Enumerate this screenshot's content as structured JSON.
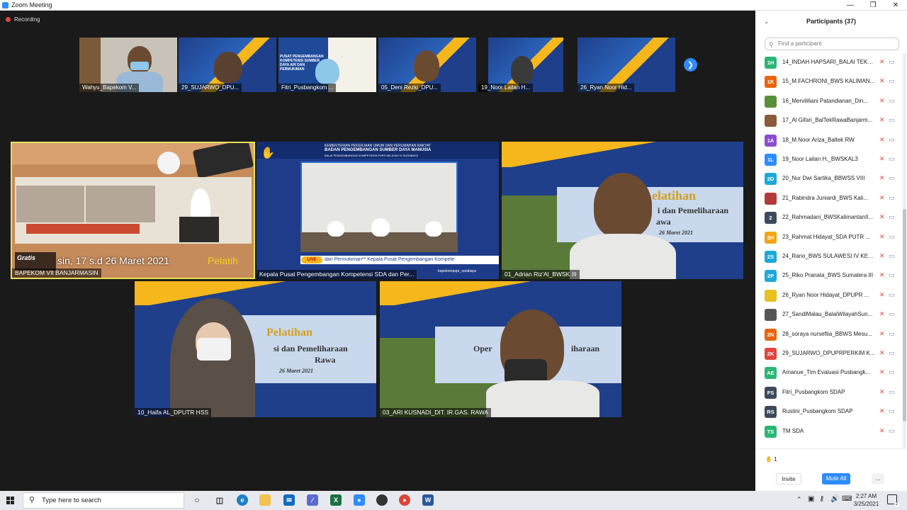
{
  "window": {
    "title": "Zoom Meeting"
  },
  "recording": {
    "label": "Recording"
  },
  "thumbnails": [
    {
      "label": "Wahyu_Bapekom V..."
    },
    {
      "label": "29_SUJARWO_DPU..."
    },
    {
      "label": "Fitri_Pusbangkom ..."
    },
    {
      "label": "05_Deni Rezki_DPU..."
    },
    {
      "label": "19_Noor Lailan H..."
    },
    {
      "label": "26_Ryan Noor Hid..."
    }
  ],
  "tiles": [
    {
      "label": "BAPEKOM VII BANJARMASIN",
      "overlay": "Gratis",
      "ticker": "sin, 17 s.d 26 Maret 2021",
      "ticker2": "Pelatih"
    },
    {
      "label": "Kepala Pusat Pengembangan Kompetensi SDA dan Per...",
      "header1": "KEMENTERIAN PEKERJAAN UMUM DAN PERUMAHAN RAKYAT",
      "header2": "BADAN PENGEMBANGAN SUMBER DAYA MANUSIA",
      "header3": "BALAI PENGEMBANGAN KOMPETENSI PUPR WILAYAH VI SURABAYA",
      "live": "LIVE",
      "ticker": "dan Permukiman** Kepala Pusat Pengembangan Kompete",
      "handle": "bapekompupr_surabaya"
    },
    {
      "label": "01_Adrian Riz'Al_BWSK III",
      "ptitle1": "elatihan",
      "ptitle2": "i dan Pemeliharaan",
      "ptitle3": "awa",
      "pdate": "26 Maret 2021"
    },
    {
      "label": "10_Haifa AL_DPUTR HSS",
      "ptitle1": "Pelatihan",
      "ptitle2": "si dan Pemeliharaan",
      "ptitle3": "Rawa",
      "pdate": "26 Maret 2021"
    },
    {
      "label": "03_ARI KUSNADI_DIT. IR.GAS. RAWA",
      "ptitle2": "Oper",
      "ptitle2b": "iharaan"
    }
  ],
  "panel": {
    "title": "Participants (37)",
    "search_placeholder": "Find a participant",
    "participants": [
      {
        "initials": "1H",
        "color": "#2bb673",
        "name": "14_INDAH HAPSARI_BALAI TEKN..."
      },
      {
        "initials": "1K",
        "color": "#e8650f",
        "name": "15_M.FACHRONI_BWS KALIMAN..."
      },
      {
        "initials": "",
        "color": "#5a8f3a",
        "name": "16_Mervililiani Patandianan_Din..."
      },
      {
        "initials": "",
        "color": "#8a5a3a",
        "name": "17_Al Gifari_BalTekRawaBanjarm..."
      },
      {
        "initials": "1A",
        "color": "#8c4dcf",
        "name": "18_M.Noor Ariza_Baltek RW"
      },
      {
        "initials": "1L",
        "color": "#2d8cff",
        "name": "19_Noor Lailan H._BWSKAL3"
      },
      {
        "initials": "2D",
        "color": "#1ea7d8",
        "name": "20_Nur Dwi Sartika_BBWSS VIII"
      },
      {
        "initials": "",
        "color": "#b33a3a",
        "name": "21_Rabindra Juniardi_BWS Kali..."
      },
      {
        "initials": "2",
        "color": "#3c4a5c",
        "name": "22_Rahmadani_BWSKalimantanII..."
      },
      {
        "initials": "2H",
        "color": "#f2a516",
        "name": "23_Rahmat Hidayat_SDA PUTR ..."
      },
      {
        "initials": "2S",
        "color": "#1ea7d8",
        "name": "24_Rano_BWS SULAWESI IV KEN..."
      },
      {
        "initials": "2P",
        "color": "#1ea7d8",
        "name": "25_Riko Pranata_BWS Sumatera III"
      },
      {
        "initials": "",
        "color": "#e8c020",
        "name": "26_Ryan Noor Hidayat_DPUPR ..."
      },
      {
        "initials": "",
        "color": "#555555",
        "name": "27_SandiMalau_BalaiWilayahSun..."
      },
      {
        "initials": "2N",
        "color": "#e8650f",
        "name": "28_soraya nurseftia_BBWS Mesu..."
      },
      {
        "initials": "2K",
        "color": "#e0463c",
        "name": "29_SUJARWO_DPUPRPERKIM K..."
      },
      {
        "initials": "AE",
        "color": "#2bb673",
        "name": "Amanue_Tim Evaluasi Pusbangk..."
      },
      {
        "initials": "FS",
        "color": "#3c4a5c",
        "name": "Fitri_Pusbangkom SDAP"
      },
      {
        "initials": "RS",
        "color": "#3c4a5c",
        "name": "Rustini_Pusbangkom SDAP"
      },
      {
        "initials": "TS",
        "color": "#2bb673",
        "name": "TM SDA"
      }
    ],
    "raised_hands": "1",
    "invite_label": "Invite",
    "mute_all_label": "Mute All",
    "more_label": "..."
  },
  "taskbar": {
    "search_placeholder": "Type here to search",
    "time": "2:27 AM",
    "date": "3/25/2021",
    "notification_count": "2"
  }
}
